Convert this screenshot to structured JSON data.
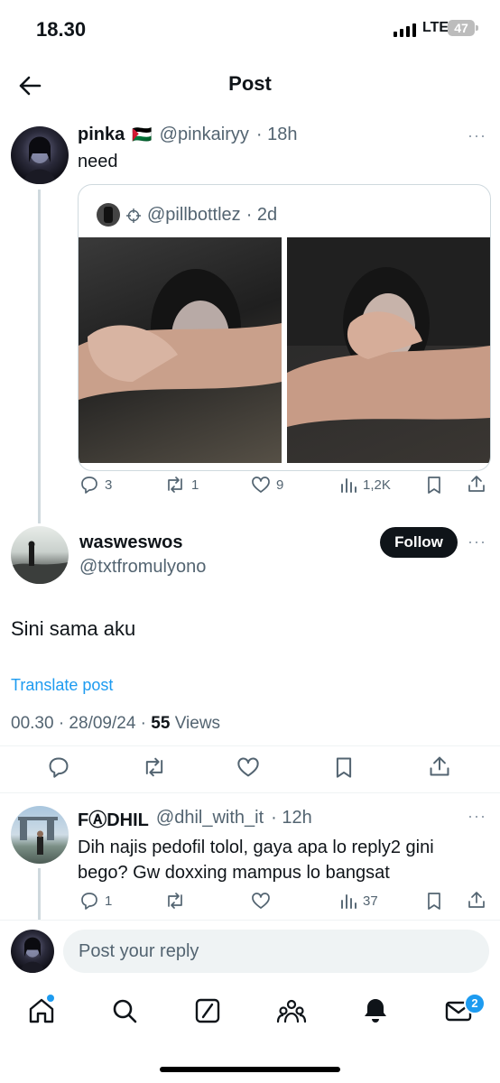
{
  "status": {
    "time": "18.30",
    "network": "LTE",
    "battery": "47"
  },
  "header": {
    "title": "Post",
    "back_icon": "arrow-left-icon"
  },
  "parent_post": {
    "name": "pinka",
    "flag": "🇵🇸",
    "handle": "@pinkairyy",
    "time": "· 18h",
    "text": "need",
    "more": "···",
    "quote": {
      "handle": "@pillbottlez",
      "time": "· 2d"
    },
    "actions": {
      "replies": "3",
      "reposts": "1",
      "likes": "9",
      "views": "1,2K"
    }
  },
  "main_post": {
    "name": "wasweswos",
    "handle": "@txtfromulyono",
    "follow_label": "Follow",
    "more": "···",
    "text": "Sini sama aku",
    "translate": "Translate post",
    "meta_time": "00.30 · 28/09/24 · ",
    "views_count": "55",
    "views_label": " Views"
  },
  "reply": {
    "name": "FⒶDHIL",
    "handle": "@dhil_with_it",
    "time": "· 12h",
    "text_line1": "Dih najis pedofil tolol, gaya apa lo reply2 gini",
    "text_line2": "bego? Gw doxxing mampus lo bangsat",
    "actions": {
      "replies": "1",
      "views": "37"
    }
  },
  "composer": {
    "placeholder": "Post your reply"
  },
  "tabbar": {
    "messages_badge": "2"
  },
  "colors": {
    "accent": "#1d9bf0",
    "text": "#0f1419",
    "muted": "#536471"
  }
}
